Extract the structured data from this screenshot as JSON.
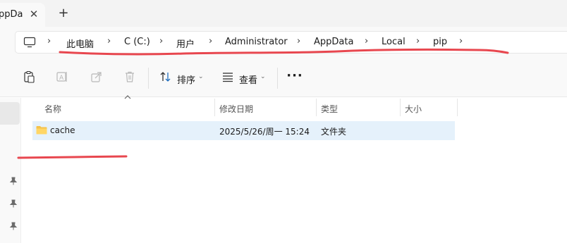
{
  "tab": {
    "title": "ppDa",
    "close": "✕",
    "new_tab": "+"
  },
  "breadcrumb": {
    "items": [
      "此电脑",
      "C (C:)",
      "用户",
      "Administrator",
      "AppData",
      "Local",
      "pip"
    ],
    "separator": "›"
  },
  "toolbar": {
    "sort_label": "排序",
    "view_label": "查看",
    "more_label": "···"
  },
  "columns": [
    "名称",
    "修改日期",
    "类型",
    "大小"
  ],
  "files": [
    {
      "name": "cache",
      "modified": "2025/5/26/周一 15:24",
      "type": "文件夹",
      "size": ""
    }
  ],
  "colors": {
    "annotation_red": "#e8474f",
    "selection": "#e5f1fb",
    "folder": "#f5c24a"
  }
}
